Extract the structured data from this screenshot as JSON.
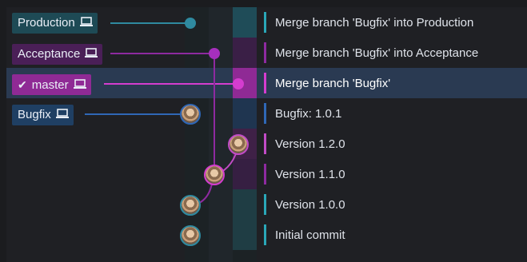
{
  "branches": [
    {
      "label": "Production",
      "icon": "laptop-icon",
      "color": "#1e4a55",
      "checked": false
    },
    {
      "label": "Acceptance",
      "icon": "laptop-icon",
      "color": "#4a1f57",
      "checked": false
    },
    {
      "label": "master",
      "icon": "laptop-icon",
      "color": "#8f2a95",
      "checked": true
    },
    {
      "label": "Bugfix",
      "icon": "laptop-icon",
      "color": "#1f3f63",
      "checked": false
    }
  ],
  "commits": [
    {
      "message": "Merge branch 'Bugfix' into Production",
      "selected": false,
      "bar_color": "#2aa7b8"
    },
    {
      "message": "Merge branch 'Bugfix' into Acceptance",
      "selected": false,
      "bar_color": "#8e2aa0"
    },
    {
      "message": "Merge branch 'Bugfix'",
      "selected": true,
      "bar_color": "#d43dcf"
    },
    {
      "message": "Bugfix: 1.0.1",
      "selected": false,
      "bar_color": "#2f67b6"
    },
    {
      "message": "Version 1.2.0",
      "selected": false,
      "bar_color": "#c14bc6"
    },
    {
      "message": "Version 1.1.0",
      "selected": false,
      "bar_color": "#8e2aa0"
    },
    {
      "message": "Version 1.0.0",
      "selected": false,
      "bar_color": "#2aa7b8"
    },
    {
      "message": "Initial commit",
      "selected": false,
      "bar_color": "#2aa7b8"
    }
  ],
  "colors": {
    "production": "#2f8aa0",
    "acceptance": "#8e2aa0",
    "master": "#d43dcf",
    "bugfix": "#2f67b6",
    "selection": "#2a3a52"
  }
}
